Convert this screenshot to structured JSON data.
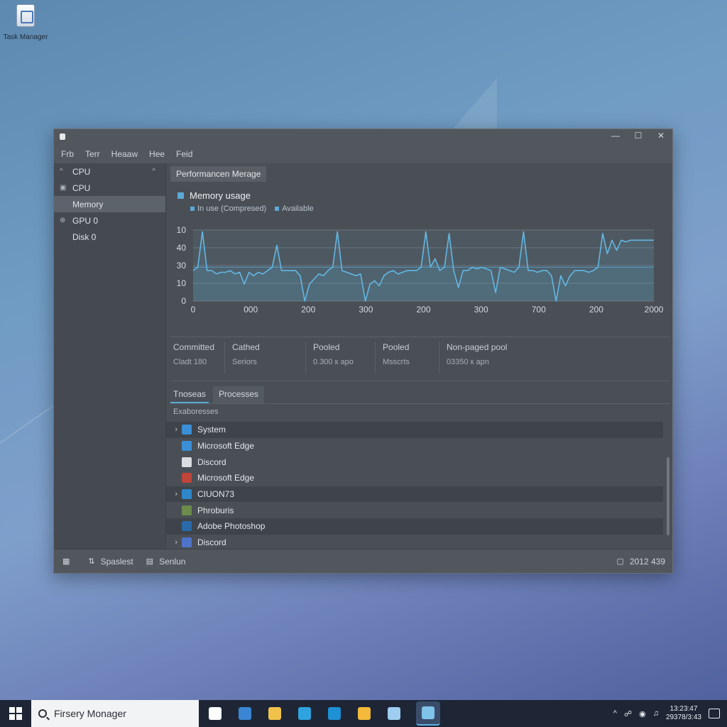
{
  "desktop": {
    "icon_label": "Task Manager"
  },
  "window": {
    "controls": {
      "minimize": "—",
      "maximize": "☐",
      "close": "✕"
    },
    "menu": [
      "Frb",
      "Terr",
      "Heaaw",
      "Hee",
      "Feid"
    ]
  },
  "sidebar": {
    "items": [
      {
        "label": "CPU",
        "icon": "chevron-up-icon"
      },
      {
        "label": "CPU",
        "icon": "cpu-icon"
      },
      {
        "label": "Memory",
        "icon": ""
      },
      {
        "label": "GPU 0",
        "icon": "gpu-icon"
      },
      {
        "label": "Disk 0",
        "icon": ""
      }
    ],
    "selected_index": 2
  },
  "main": {
    "tab_header": "Performancen Merage",
    "graph_title": "Memory usage",
    "legend": [
      "In use (Compresed)",
      "Available"
    ]
  },
  "chart_data": {
    "type": "line",
    "title": "Memory usage",
    "y_ticks": [
      "10",
      "40",
      "30",
      "10",
      "0"
    ],
    "x_ticks": [
      "0",
      "000",
      "200",
      "300",
      "200",
      "300",
      "700",
      "200",
      "2000"
    ],
    "series": [
      {
        "name": "In use (Compresed)",
        "color": "#63b7e3",
        "x": [
          0,
          1,
          2,
          3,
          4,
          5,
          6,
          7,
          8,
          9,
          10,
          11,
          12,
          13,
          14,
          15,
          16,
          17,
          18,
          19,
          20,
          21,
          22,
          23,
          24,
          25,
          26,
          27,
          28,
          29,
          30,
          31,
          32,
          33,
          34,
          35,
          36,
          37,
          38,
          39,
          40,
          41,
          42,
          43,
          44,
          45,
          46,
          47,
          48,
          49,
          50,
          51,
          52,
          53,
          54,
          55,
          56,
          57,
          58,
          59,
          60,
          61,
          62,
          63,
          64,
          65,
          66,
          67,
          68,
          69,
          70,
          71,
          72,
          73,
          74,
          75,
          76,
          77,
          78,
          79,
          80,
          81,
          82,
          83,
          84,
          85,
          86,
          87,
          88,
          89,
          90,
          91,
          92,
          93,
          94,
          95,
          96,
          97,
          98,
          99
        ],
        "values": [
          18,
          20,
          41,
          18,
          18,
          16,
          17,
          17,
          18,
          16,
          17,
          10,
          17,
          15,
          17,
          16,
          18,
          20,
          33,
          18,
          18,
          18,
          18,
          15,
          0,
          10,
          13,
          16,
          15,
          18,
          20,
          41,
          18,
          17,
          16,
          15,
          16,
          0,
          10,
          12,
          9,
          15,
          17,
          18,
          16,
          17,
          18,
          18,
          18,
          20,
          41,
          20,
          25,
          18,
          20,
          40,
          18,
          8,
          18,
          18,
          20,
          19,
          20,
          19,
          18,
          5,
          20,
          19,
          18,
          17,
          20,
          41,
          18,
          18,
          17,
          18,
          18,
          15,
          0,
          15,
          9,
          15,
          18,
          18,
          18,
          17,
          18,
          20,
          40,
          28,
          36,
          30,
          36,
          35,
          36,
          36,
          36,
          36,
          36,
          36
        ]
      },
      {
        "name": "Available",
        "color": "#5aa9d6",
        "x": [
          0,
          99
        ],
        "values": [
          20,
          20
        ]
      }
    ],
    "ylim": [
      0,
      42
    ],
    "xlim": [
      0,
      99
    ],
    "grid": true
  },
  "stats": [
    {
      "label": "Committed",
      "value": "Cladt 180"
    },
    {
      "label": "Cathed",
      "value": "Seriors"
    },
    {
      "label": "Pooled",
      "value": "0.300 к apo"
    },
    {
      "label": "Pooled",
      "value": "Msscrts"
    },
    {
      "label": "Non-paged pool",
      "value": "03350 к apn"
    }
  ],
  "tabs": [
    "Tnoseas",
    "Processes"
  ],
  "subheader": "Exaboresses",
  "processes": [
    {
      "name": "System",
      "expand": "›",
      "icon": "check-icon",
      "icon_color": "#3a8fd6",
      "dark": true
    },
    {
      "name": "Microsoft Edge",
      "expand": "",
      "icon": "check-icon",
      "icon_color": "#3a8fd6",
      "dark": false
    },
    {
      "name": "Discord",
      "expand": "",
      "icon": "document-icon",
      "icon_color": "#d9dde2",
      "dark": false
    },
    {
      "name": "Microsoft Edge",
      "expand": "",
      "icon": "edge-icon",
      "icon_color": "#c0443a",
      "dark": false
    },
    {
      "name": "CIUON73",
      "expand": "›",
      "icon": "cloud-icon",
      "icon_color": "#2f86c9",
      "dark": true
    },
    {
      "name": "Phroburis",
      "expand": "",
      "icon": "photo-icon",
      "icon_color": "#6b8c4a",
      "dark": false
    },
    {
      "name": "Adobe Photoshop",
      "expand": "",
      "icon": "brush-icon",
      "icon_color": "#2a6aa8",
      "dark": true
    },
    {
      "name": "Discord",
      "expand": "›",
      "icon": "discord-icon",
      "icon_color": "#4e73c9",
      "dark": false
    }
  ],
  "statusbar": {
    "left": [
      {
        "icon": "windows-icon",
        "label": ""
      },
      {
        "icon": "snapshot-icon",
        "label": "Spaslest"
      },
      {
        "icon": "printer-icon",
        "label": "Senlun"
      }
    ],
    "right": "2012 439"
  },
  "taskbar": {
    "search_text": "Firsery Monager",
    "apps": [
      {
        "icon": "windows-icon",
        "color": "#ffffff"
      },
      {
        "icon": "store-icon",
        "color": "#3a86d4"
      },
      {
        "icon": "folder-icon",
        "color": "#f1c24b"
      },
      {
        "icon": "edge-icon",
        "color": "#2fa3e0"
      },
      {
        "icon": "edge-icon",
        "color": "#1e90d4"
      },
      {
        "icon": "folder-icon",
        "color": "#f4b93a"
      },
      {
        "icon": "apps-icon",
        "color": "#9ecdf0"
      },
      {
        "icon": "task-manager-icon",
        "color": "#7fc2ea"
      }
    ],
    "time": "13:23:47",
    "date": "29378/3:43"
  }
}
